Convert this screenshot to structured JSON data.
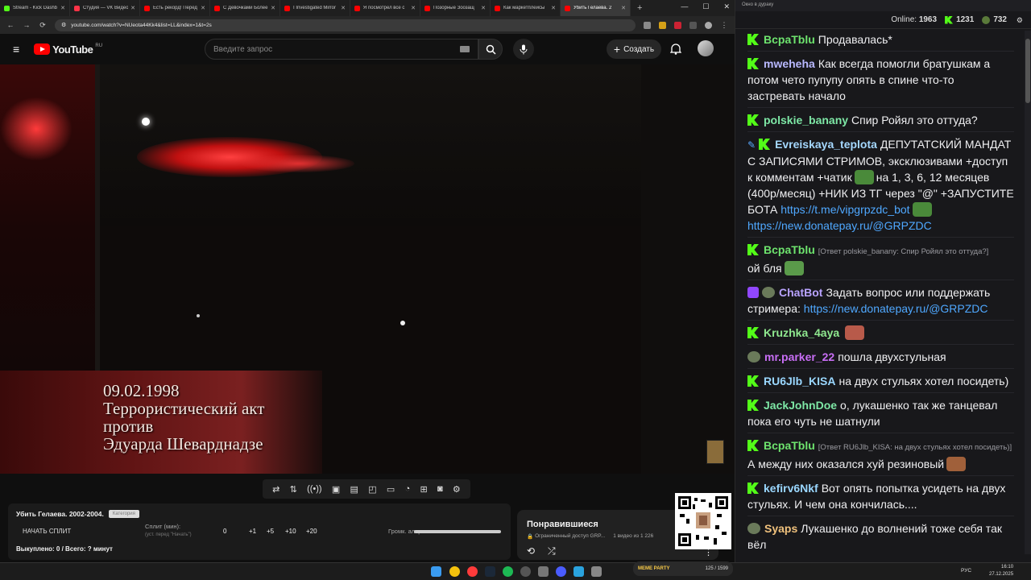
{
  "browser": {
    "tabs": [
      {
        "label": "Stream - Kick Dashb",
        "color": "#53fc18",
        "active": false
      },
      {
        "label": "Студия — VK Видео",
        "color": "#ff3347",
        "active": false
      },
      {
        "label": "Есть рекорд! Перед",
        "color": "#ff0000",
        "active": false
      },
      {
        "label": "С Девочками Более",
        "color": "#ff0000",
        "active": false
      },
      {
        "label": "I Investigated Mirror",
        "color": "#ff0000",
        "active": false
      },
      {
        "label": "Я посмотрел все с",
        "color": "#ff0000",
        "active": false
      },
      {
        "label": "Позорные Зоозащ",
        "color": "#ff0000",
        "active": false
      },
      {
        "label": "Как маркетплейсы",
        "color": "#ff0000",
        "active": false
      },
      {
        "label": "Убить Гелаева. 2",
        "color": "#ff0000",
        "active": true
      }
    ],
    "url": "youtube.com/watch?v=NUeota44Kk4&list=LL&index=1&t=2s",
    "win_controls": [
      "—",
      "☐",
      "✕"
    ]
  },
  "youtube": {
    "logo_text": "YouTube",
    "region": "RU",
    "search_placeholder": "Введите запрос",
    "create_label": "Создать"
  },
  "video": {
    "caption_lines": [
      "09.02.1998",
      "Террористический акт",
      "против",
      "Эдуарда Шеварднадзе"
    ]
  },
  "split_panel": {
    "title": "Убить Гелаева. 2002-2004.",
    "title_tag": "Категория",
    "start_label": "НАЧАТЬ СПЛИТ",
    "split_label": "Сплит (мин):",
    "split_hint": "(уст. перед \"Начать\")",
    "split_value": "0",
    "increments": [
      "+1",
      "+5",
      "+10",
      "+20"
    ],
    "volume_label": "Громк. алерта:",
    "status": "Выкуплено: 0 / Всего: ? минут"
  },
  "liked": {
    "title": "Понравившиеся",
    "meta": "Ограниченный доступ GRP...",
    "count": "1 видео из 1 226"
  },
  "chat": {
    "window_title": "Окно в дураку",
    "online_label": "Online:",
    "online_count": "1963",
    "kick_count": "1231",
    "other_count": "732",
    "messages": [
      {
        "user": "BcpaTblu",
        "color": "#6ee46e",
        "text": "Продавалась*"
      },
      {
        "user": "mweheha",
        "color": "#b9b9ff",
        "text": "Как всегда помогли братушкам а потом чето пупупу опять в спине что-то застревать начало"
      },
      {
        "user": "polskie_banany",
        "color": "#7ee8a6",
        "text": "Спир Ройял это оттуда?"
      },
      {
        "user": "Evreiskaya_teplota",
        "color": "#a5d8ff",
        "text1": "ДЕПУТАТСКИЙ МАНДАТ С ЗАПИСЯМИ СТРИМОВ, эксклюзивами +доступ к комментам +чатик",
        "text2": "на 1, 3, 6, 12 месяцев (400р/месяц) +НИК ИЗ ТГ через \"@\" +ЗАПУСТИТЕ БОТА",
        "link1": "https://t.me/vipgrpzdc_bot",
        "link2": "https://new.donatepay.ru/@GRPZDC"
      },
      {
        "user": "BcpaTblu",
        "color": "#6ee46e",
        "reply": "[Ответ polskie_banany: Спир Ройял это оттуда?]",
        "text": "ой бля"
      },
      {
        "user": "ChatBot",
        "color": "#b9a3ff",
        "text": "Задать вопрос или поддержать стримера:",
        "link": "https://new.donatepay.ru/@GRPZDC"
      },
      {
        "user": "Kruzhka_4aya",
        "color": "#8fe88f",
        "text": ""
      },
      {
        "user": "mr.parker_22",
        "color": "#c86ef5",
        "text": "пошла двухстульная"
      },
      {
        "user": "RU6Jlb_KISA",
        "color": "#9ad7ff",
        "text": "на двух стульях хотел посидеть)"
      },
      {
        "user": "JackJohnDoe",
        "color": "#7ee8a6",
        "text": "о, лукашенко так же танцевал пока его чуть не шатнули"
      },
      {
        "user": "BcpaTblu",
        "color": "#6ee46e",
        "reply": "[Ответ RU6Jlb_KISA: на двух стульях хотел посидеть)]",
        "text": "А между них оказался хуй резиновый"
      },
      {
        "user": "kefirv6Nkf",
        "color": "#9ad7ff",
        "text": "Вот опять попытка усидеть на двух стульях. И чем она кончилась...."
      },
      {
        "user": "Syaps",
        "color": "#f1c27d",
        "text": "Лукашенко до волнений тоже себя так вёл"
      }
    ]
  },
  "taskbar": {
    "lang": "РУС",
    "time": "16:10",
    "date": "27.12.2025",
    "widget_label": "MEME PARTY",
    "widget_count": "125 / 1599"
  }
}
